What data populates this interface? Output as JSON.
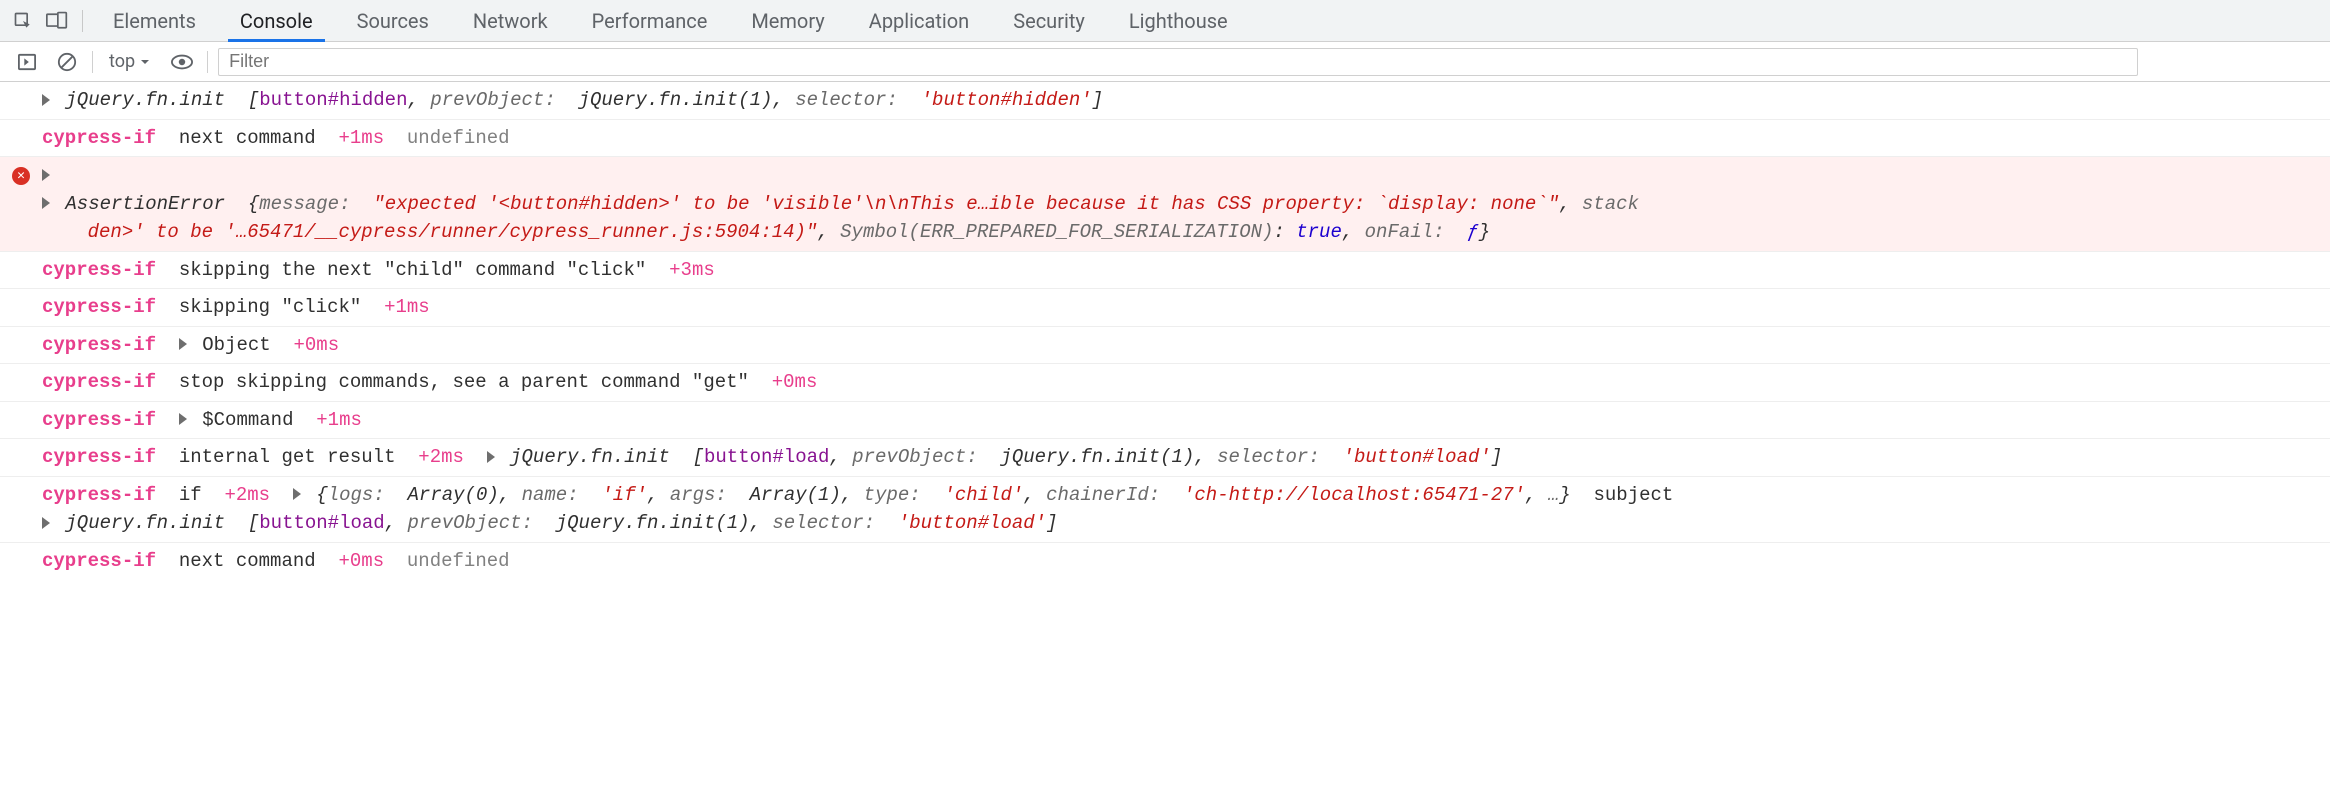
{
  "tabs": {
    "items": [
      "Elements",
      "Console",
      "Sources",
      "Network",
      "Performance",
      "Memory",
      "Application",
      "Security",
      "Lighthouse"
    ],
    "active": "Console"
  },
  "toolbar": {
    "context": "top",
    "filter_placeholder": "Filter"
  },
  "tokens": {
    "ns": "cypress-if",
    "undefined": "undefined",
    "jquery_init": "jQuery.fn.init",
    "prevObject_label": "prevObject:",
    "prevObject_value": "jQuery.fn.init(1)",
    "selector_label": "selector:",
    "message_label": "message:",
    "symbol_label": "Symbol(ERR_PREPARED_FOR_SERIALIZATION)",
    "onFail_label": "onFail:",
    "true": "true",
    "f": "ƒ",
    "Object": "Object",
    "Command": "$Command",
    "logs_label": "logs:",
    "logs_val": "Array(0)",
    "name_label": "name:",
    "args_label": "args:",
    "args_val": "Array(1)",
    "type_label": "type:",
    "chainerId_label": "chainerId:",
    "ellipsis": "…",
    "subject": "subject",
    "stack_label": "stack"
  },
  "rows": {
    "r1_selector": "button#hidden",
    "r1_selector_str": "'button#hidden'",
    "r2_text": "next command",
    "r2_ms": "+1ms",
    "err_name": "AssertionError",
    "err_msg": "\"expected '<button#hidden>' to be 'visible'\\n\\nThis e…ible because it has CSS property: `display: none`\"",
    "err_line2a": "den>' to be '…65471/__cypress/runner/cypress_runner.js:5904:14)\"",
    "r4_text": "skipping the next \"child\" command \"click\"",
    "r4_ms": "+3ms",
    "r5_text": "skipping \"click\"",
    "r5_ms": "+1ms",
    "r6_ms": "+0ms",
    "r7_text": "stop skipping commands, see a parent command \"get\"",
    "r7_ms": "+0ms",
    "r8_ms": "+1ms",
    "r9_text": "internal get result",
    "r9_ms": "+2ms",
    "r9_selector": "button#load",
    "r9_selector_str": "'button#load'",
    "r10_text": "if",
    "r10_ms": "+2ms",
    "r10_name_val": "'if'",
    "r10_type_val": "'child'",
    "r10_chainer_val": "'ch-http://localhost:65471-27'",
    "r10b_selector": "button#load",
    "r10b_selector_str": "'button#load'",
    "r11_text": "next command",
    "r11_ms": "+0ms"
  }
}
